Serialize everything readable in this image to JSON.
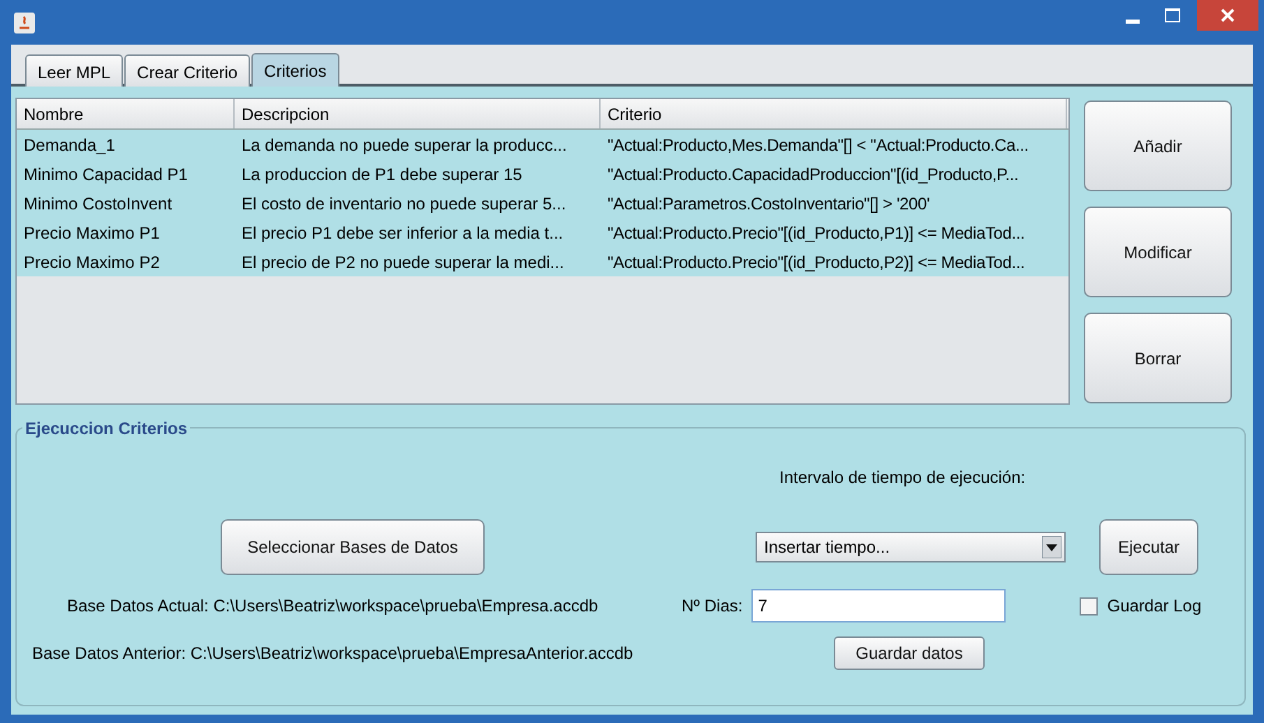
{
  "tabs": [
    {
      "label": "Leer MPL",
      "selected": false
    },
    {
      "label": "Crear Criterio",
      "selected": false
    },
    {
      "label": "Criterios",
      "selected": true
    }
  ],
  "table": {
    "columns": [
      "Nombre",
      "Descripcion",
      "Criterio"
    ],
    "rows": [
      [
        "Demanda_1",
        "La demanda no puede superar la producc...",
        "\"Actual:Producto,Mes.Demanda\"[] < \"Actual:Producto.Ca..."
      ],
      [
        "Minimo Capacidad P1",
        "La produccion de P1 debe superar 15",
        "\"Actual:Producto.CapacidadProduccion\"[(id_Producto,P..."
      ],
      [
        "Minimo CostoInvent",
        "El costo de inventario no puede superar 5...",
        "\"Actual:Parametros.CostoInventario\"[] > '200'"
      ],
      [
        "Precio Maximo P1",
        "El precio P1 debe ser inferior a la media t...",
        "\"Actual:Producto.Precio\"[(id_Producto,P1)] <= MediaTod..."
      ],
      [
        "Precio Maximo P2",
        "El precio de P2 no puede superar la medi...",
        "\"Actual:Producto.Precio\"[(id_Producto,P2)] <= MediaTod..."
      ]
    ]
  },
  "side_buttons": [
    "Añadir",
    "Modificar",
    "Borrar"
  ],
  "execution": {
    "title": "Ejecuccion Criterios",
    "interval_label": "Intervalo de tiempo de ejecución:",
    "select_db_button": "Seleccionar Bases de Datos",
    "interval_select": "Insertar tiempo...",
    "execute_button": "Ejecutar",
    "current_db": "Base Datos Actual: C:\\Users\\Beatriz\\workspace\\prueba\\Empresa.accdb",
    "days_label": "Nº Dias:",
    "days_value": "7",
    "log_checkbox": {
      "label": "Guardar Log",
      "checked": false
    },
    "previous_db": "Base Datos Anterior: C:\\Users\\Beatriz\\workspace\\prueba\\EmpresaAnterior.accdb",
    "save_button": "Guardar datos"
  }
}
